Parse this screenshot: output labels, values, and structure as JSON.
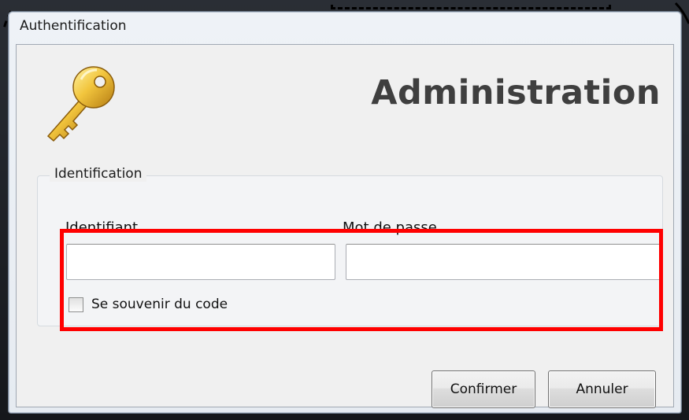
{
  "window": {
    "title": "Authentification"
  },
  "header": {
    "title": "Administration",
    "icon": "key-icon"
  },
  "group": {
    "legend": "Identification"
  },
  "form": {
    "username_label": "Identifiant",
    "username_value": "",
    "password_label": "Mot de passe",
    "password_value": "",
    "remember_label": "Se souvenir du code",
    "remember_checked": false
  },
  "buttons": {
    "confirm_label": "Confirmer",
    "cancel_label": "Annuler"
  },
  "colors": {
    "highlight": "#ff0000",
    "key_gold": "#f2c53d",
    "heading": "#3f3f3f"
  }
}
